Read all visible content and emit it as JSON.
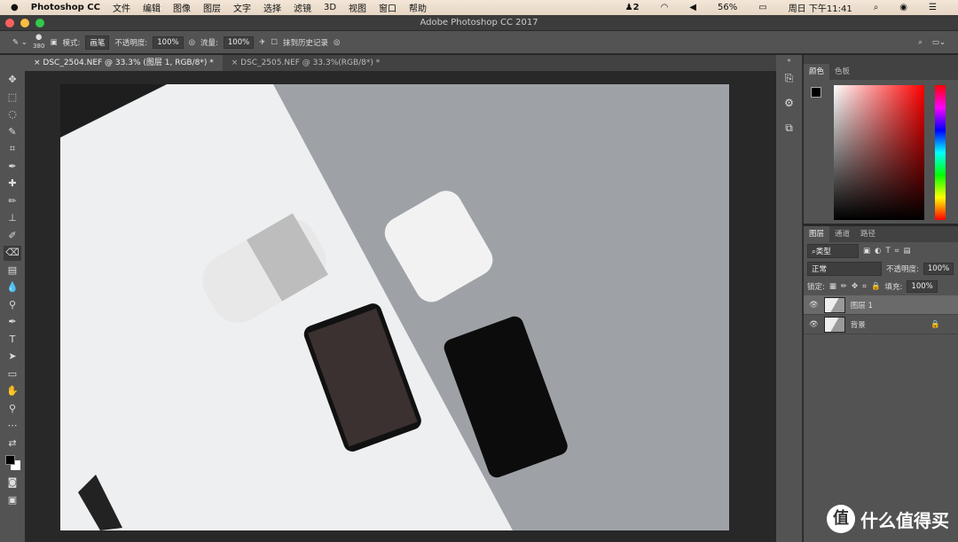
{
  "menubar": {
    "app": "Photoshop CC",
    "items": [
      "文件",
      "编辑",
      "图像",
      "图层",
      "文字",
      "选择",
      "滤镜",
      "3D",
      "视图",
      "窗口",
      "帮助"
    ],
    "qq_count": "2",
    "battery": "56%",
    "clock": "周日 下午11:41"
  },
  "window": {
    "title": "Adobe Photoshop CC 2017"
  },
  "options": {
    "brush_size": "380",
    "mode_label": "模式:",
    "mode_value": "画笔",
    "opacity_label": "不透明度:",
    "opacity_value": "100%",
    "flow_label": "流量:",
    "flow_value": "100%",
    "history_label": "抹到历史记录"
  },
  "tabs": [
    {
      "label": "DSC_2504.NEF @ 33.3% (图层 1, RGB/8*) *"
    },
    {
      "label": "DSC_2505.NEF @ 33.3%(RGB/8*) *"
    }
  ],
  "color_panel": {
    "tabs": [
      "颜色",
      "色板"
    ]
  },
  "layers_panel": {
    "tabs": [
      "图层",
      "通道",
      "路径"
    ],
    "filter": "类型",
    "blend_mode": "正常",
    "opacity_label": "不透明度:",
    "opacity_value": "100%",
    "lock_label": "锁定:",
    "fill_label": "填充:",
    "fill_value": "100%",
    "layers": [
      {
        "name": "图层 1"
      },
      {
        "name": "背景"
      }
    ]
  },
  "watermark": {
    "text": "什么值得买",
    "icon": "值"
  }
}
